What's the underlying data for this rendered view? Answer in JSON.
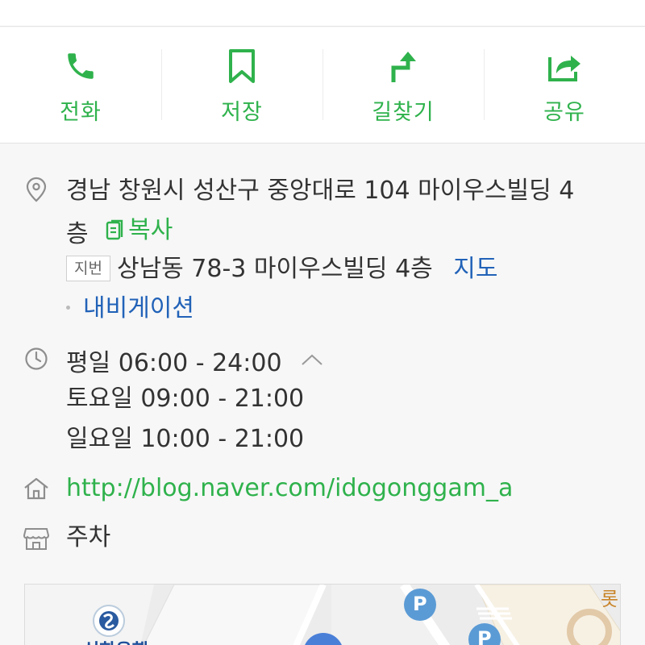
{
  "actions": [
    {
      "label": "전화",
      "icon": "phone-icon"
    },
    {
      "label": "저장",
      "icon": "bookmark-icon"
    },
    {
      "label": "길찾기",
      "icon": "directions-icon"
    },
    {
      "label": "공유",
      "icon": "share-icon"
    }
  ],
  "address": {
    "line1": "경남 창원시 성산구 중앙대로 104 마이우스빌딩 4",
    "line2": "층",
    "copy_label": "복사",
    "jibun_badge": "지번",
    "jibun_address": "상남동 78-3 마이우스빌딩 4층",
    "map_link": "지도",
    "navigation_link": "내비게이션"
  },
  "hours": {
    "weekday": "평일 06:00 - 24:00",
    "saturday": "토요일 09:00 - 21:00",
    "sunday": "일요일 10:00 - 21:00"
  },
  "website": "http://blog.naver.com/idogonggam_a",
  "facility": "주차",
  "map": {
    "poi_label": "롯",
    "parking_label": "P",
    "partial_label": "신한은행"
  },
  "colors": {
    "accent_green": "#2fb24c",
    "link_blue": "#2162b8",
    "parking_blue": "#5b9bd5"
  }
}
